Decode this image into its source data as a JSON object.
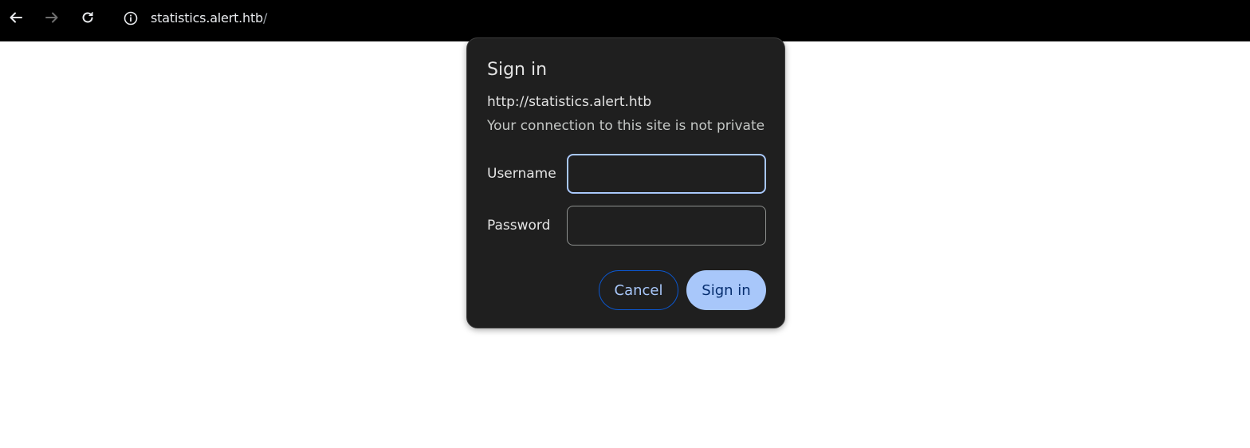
{
  "browser": {
    "url_host": "statistics.alert.htb",
    "url_path": "/",
    "icons": [
      "back-arrow-icon",
      "forward-arrow-icon",
      "reload-icon",
      "site-info-icon"
    ]
  },
  "dialog": {
    "title": "Sign in",
    "origin": "http://statistics.alert.htb",
    "warning": "Your connection to this site is not private",
    "username_label": "Username",
    "username_value": "",
    "password_label": "Password",
    "password_value": "",
    "cancel_label": "Cancel",
    "signin_label": "Sign in"
  },
  "colors": {
    "toolbar_bg": "#000000",
    "dialog_bg": "#1f1f1f",
    "accent": "#a8c7fa",
    "page_bg": "#ffffff"
  }
}
